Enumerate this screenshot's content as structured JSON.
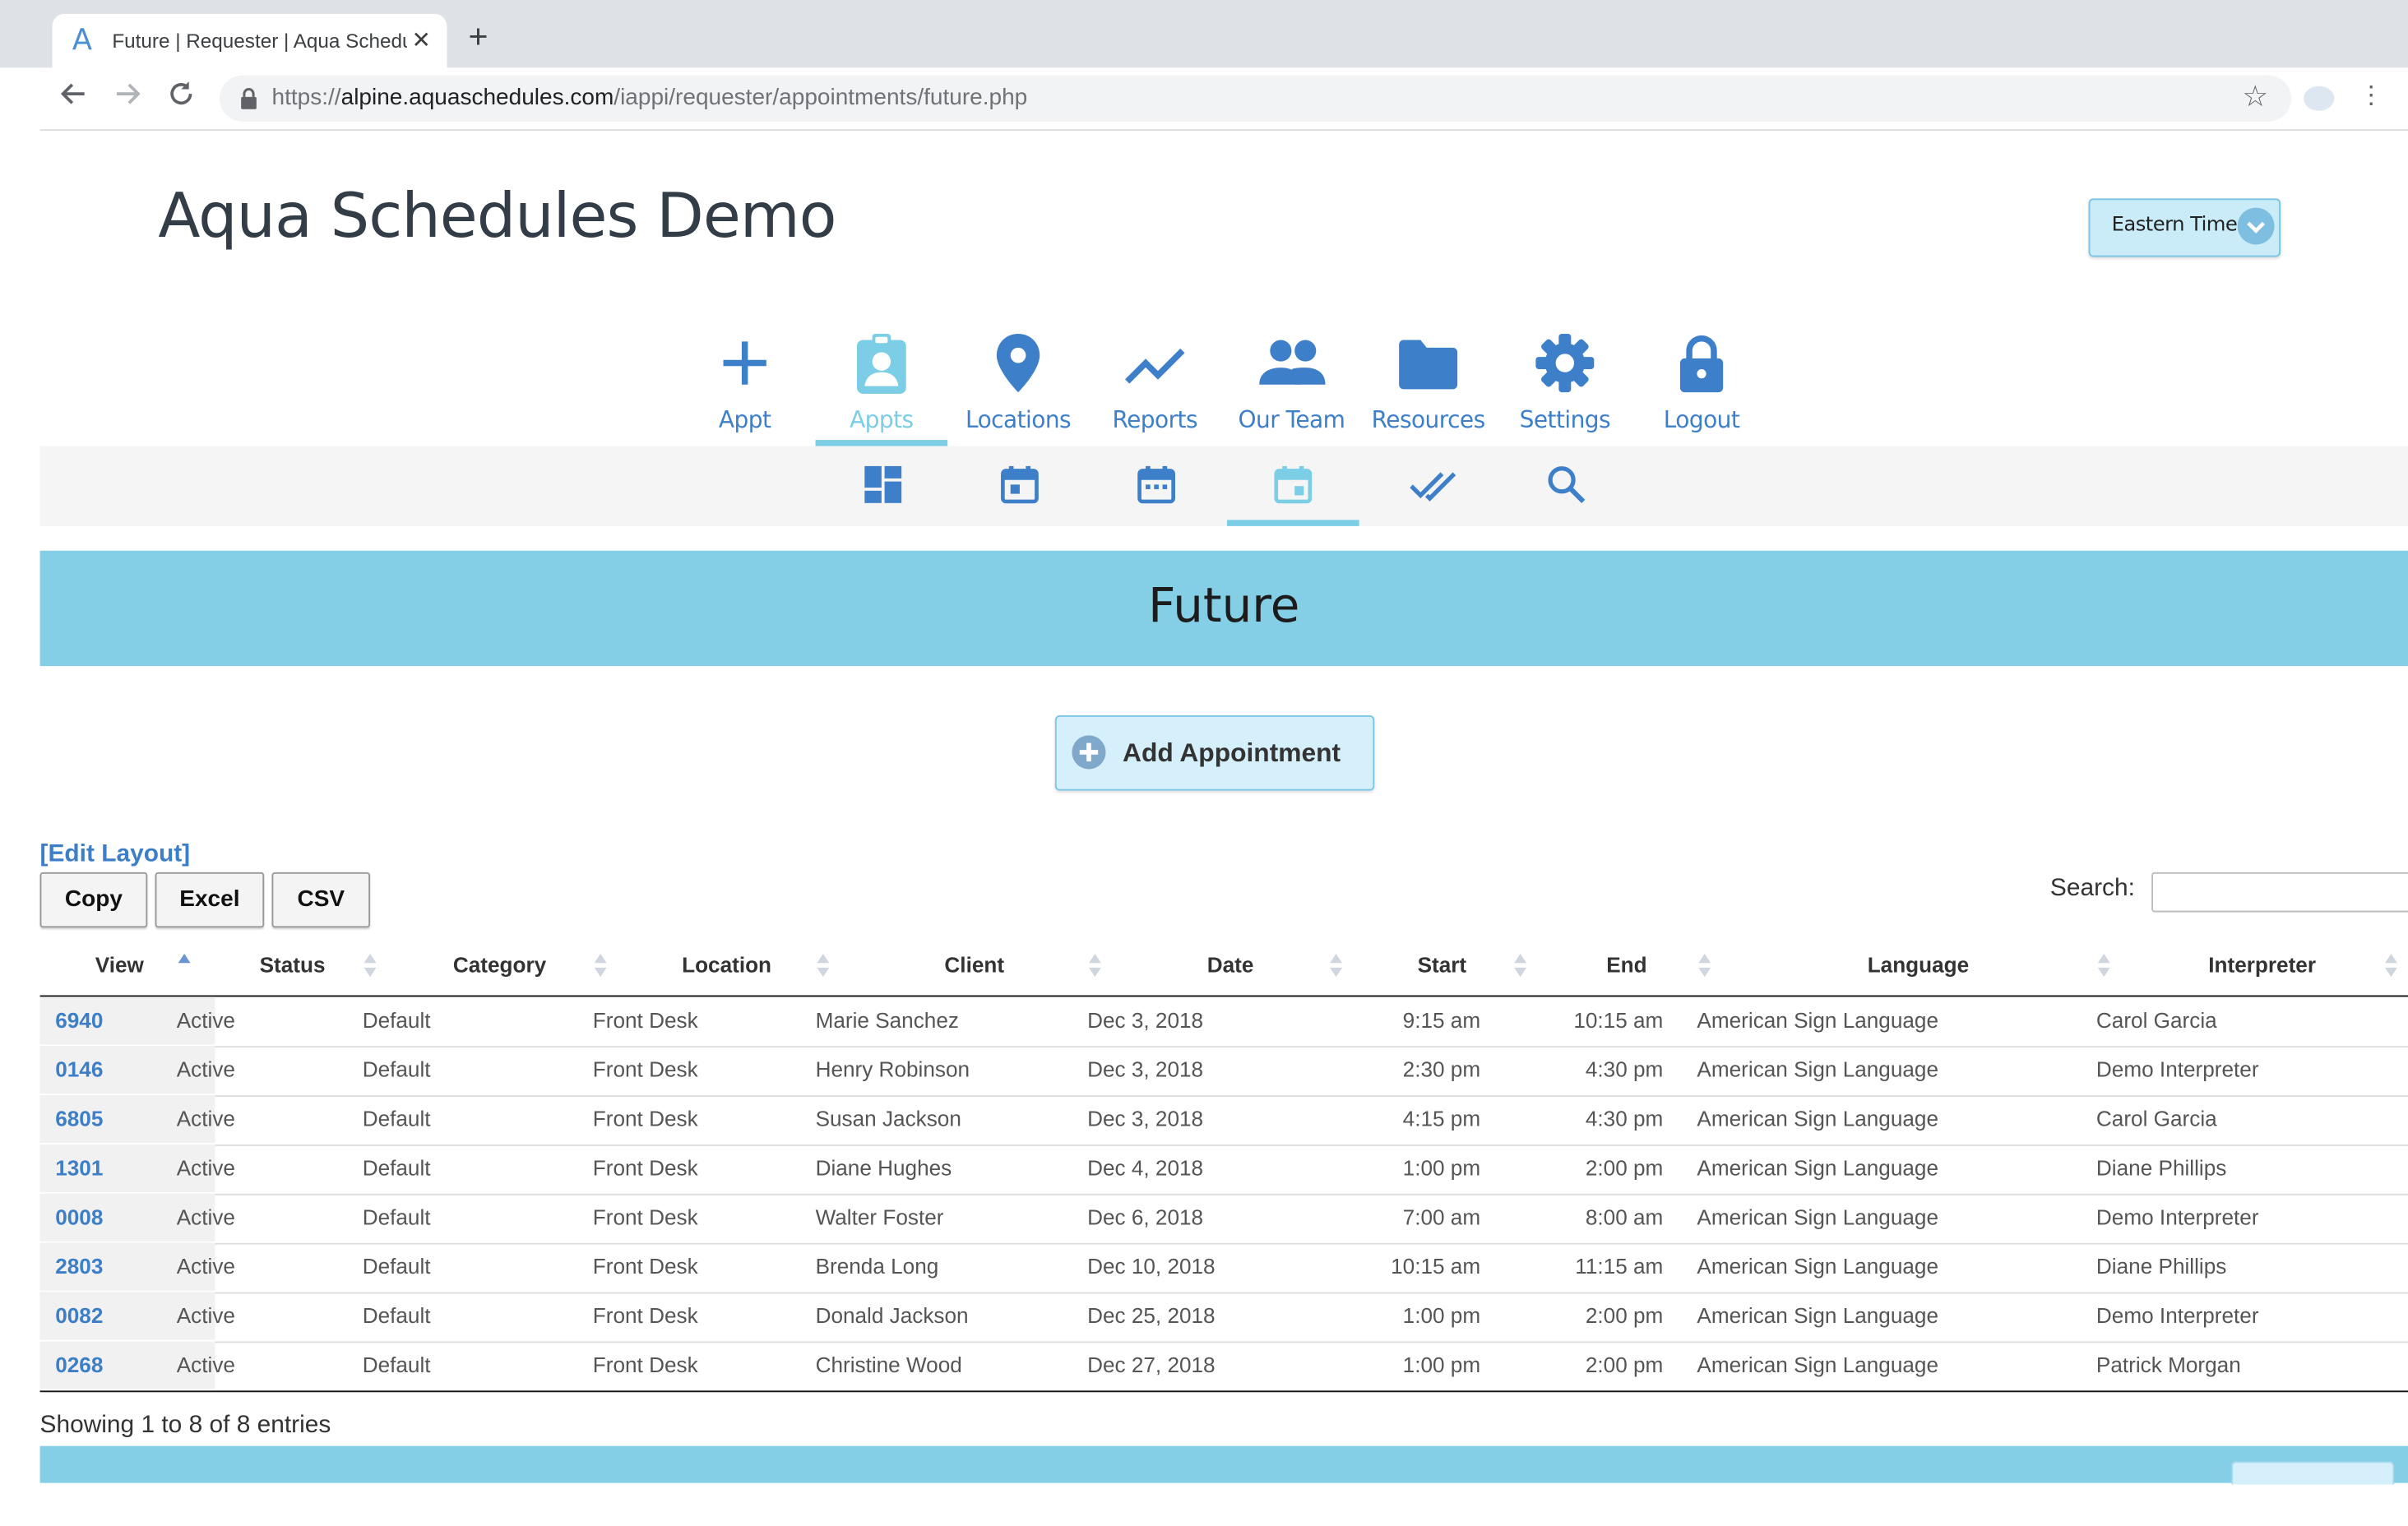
{
  "browser": {
    "tab_title": "Future | Requester | Aqua Schedules Demo",
    "tab_favicon": "A",
    "url_host_prefix": "https://",
    "url_host": "alpine.aquaschedules.com",
    "url_path": "/iappi/requester/appointments/future.php"
  },
  "header": {
    "site_title": "Aqua Schedules Demo",
    "timezone_label": "Eastern Time"
  },
  "main_nav": [
    {
      "label": "Appt",
      "icon": "plus-icon"
    },
    {
      "label": "Appts",
      "icon": "clipboard-user-icon",
      "active": true
    },
    {
      "label": "Locations",
      "icon": "map-pin-icon"
    },
    {
      "label": "Reports",
      "icon": "trend-line-icon"
    },
    {
      "label": "Our Team",
      "icon": "people-icon"
    },
    {
      "label": "Resources",
      "icon": "folder-icon"
    },
    {
      "label": "Settings",
      "icon": "gear-icon"
    },
    {
      "label": "Logout",
      "icon": "lock-icon"
    }
  ],
  "sub_nav": [
    {
      "icon": "dashboard-icon"
    },
    {
      "icon": "calendar-day-icon"
    },
    {
      "icon": "calendar-week-icon"
    },
    {
      "icon": "calendar-future-icon",
      "active": true
    },
    {
      "icon": "double-check-icon"
    },
    {
      "icon": "search-icon"
    }
  ],
  "page": {
    "banner_title": "Future",
    "add_button_label": "Add Appointment",
    "edit_layout_label": "[Edit Layout]",
    "export_buttons": [
      "Copy",
      "Excel",
      "CSV"
    ],
    "search_label": "Search:",
    "search_value": "",
    "footer_info": "Showing 1 to 8 of 8 entries"
  },
  "table": {
    "columns": [
      "View",
      "Status",
      "Category",
      "Location",
      "Client",
      "Date",
      "Start",
      "End",
      "Language",
      "Interpreter"
    ],
    "sorted_column": "View",
    "sort_direction": "ascending",
    "rows": [
      [
        "6940",
        "Active",
        "Default",
        "Front Desk",
        "Marie Sanchez",
        "Dec 3, 2018",
        "9:15 am",
        "10:15 am",
        "American Sign Language",
        "Carol Garcia"
      ],
      [
        "0146",
        "Active",
        "Default",
        "Front Desk",
        "Henry Robinson",
        "Dec 3, 2018",
        "2:30 pm",
        "4:30 pm",
        "American Sign Language",
        "Demo Interpreter"
      ],
      [
        "6805",
        "Active",
        "Default",
        "Front Desk",
        "Susan Jackson",
        "Dec 3, 2018",
        "4:15 pm",
        "4:30 pm",
        "American Sign Language",
        "Carol Garcia"
      ],
      [
        "1301",
        "Active",
        "Default",
        "Front Desk",
        "Diane Hughes",
        "Dec 4, 2018",
        "1:00 pm",
        "2:00 pm",
        "American Sign Language",
        "Diane Phillips"
      ],
      [
        "0008",
        "Active",
        "Default",
        "Front Desk",
        "Walter Foster",
        "Dec 6, 2018",
        "7:00 am",
        "8:00 am",
        "American Sign Language",
        "Demo Interpreter"
      ],
      [
        "2803",
        "Active",
        "Default",
        "Front Desk",
        "Brenda Long",
        "Dec 10, 2018",
        "10:15 am",
        "11:15 am",
        "American Sign Language",
        "Diane Phillips"
      ],
      [
        "0082",
        "Active",
        "Default",
        "Front Desk",
        "Donald Jackson",
        "Dec 25, 2018",
        "1:00 pm",
        "2:00 pm",
        "American Sign Language",
        "Demo Interpreter"
      ],
      [
        "0268",
        "Active",
        "Default",
        "Front Desk",
        "Christine Wood",
        "Dec 27, 2018",
        "1:00 pm",
        "2:00 pm",
        "American Sign Language",
        "Patrick Morgan"
      ]
    ]
  },
  "colors": {
    "accent_blue": "#3e7fc9",
    "active_cyan": "#7ccde6",
    "banner": "#84cfe5"
  }
}
